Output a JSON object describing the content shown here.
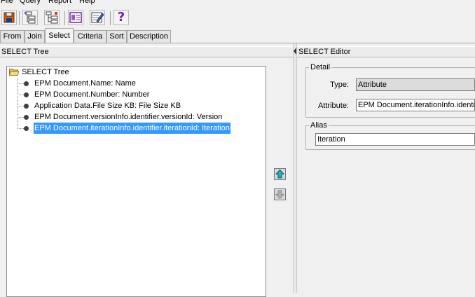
{
  "menu": {
    "items": [
      {
        "label": "File"
      },
      {
        "label": "Query"
      },
      {
        "label": "Report"
      },
      {
        "label": "Help"
      }
    ]
  },
  "toolbar": {
    "icons": [
      "save-icon",
      "query-structure-icon",
      "query-tree-icon",
      "report-icon",
      "edit-report-icon",
      "help-icon"
    ],
    "help_glyph": "?"
  },
  "tabs": [
    {
      "label": "From"
    },
    {
      "label": "Join"
    },
    {
      "label": "Select",
      "active": true
    },
    {
      "label": "Criteria"
    },
    {
      "label": "Sort"
    },
    {
      "label": "Description"
    }
  ],
  "select_tree": {
    "panel_title": "SELECT Tree",
    "root_label": "SELECT Tree",
    "items": [
      {
        "label": "EPM Document.Name: Name"
      },
      {
        "label": "EPM Document.Number: Number"
      },
      {
        "label": "Application Data.File Size KB: File Size KB"
      },
      {
        "label": "EPM Document.versionInfo.identifier.versionId: Version"
      },
      {
        "label": "EPM Document.iterationInfo.identifier.iterationId: Iteration",
        "selected": true
      }
    ]
  },
  "move_buttons": {
    "up_icon": "move-up-arrow-icon",
    "down_icon": "move-down-arrow-icon",
    "down_enabled": false
  },
  "select_editor": {
    "panel_title": "SELECT Editor",
    "detail": {
      "group_title": "Detail",
      "type_label": "Type:",
      "type_value": "Attribute",
      "attribute_label": "Attribute:",
      "attribute_value": "EPM Document.iterationInfo.identi"
    },
    "alias": {
      "group_title": "Alias",
      "value": "Iteration"
    }
  },
  "colors": {
    "selection": "#3399ff",
    "up_arrow": "#18b4c8",
    "help_purple": "#7a1fa2"
  }
}
